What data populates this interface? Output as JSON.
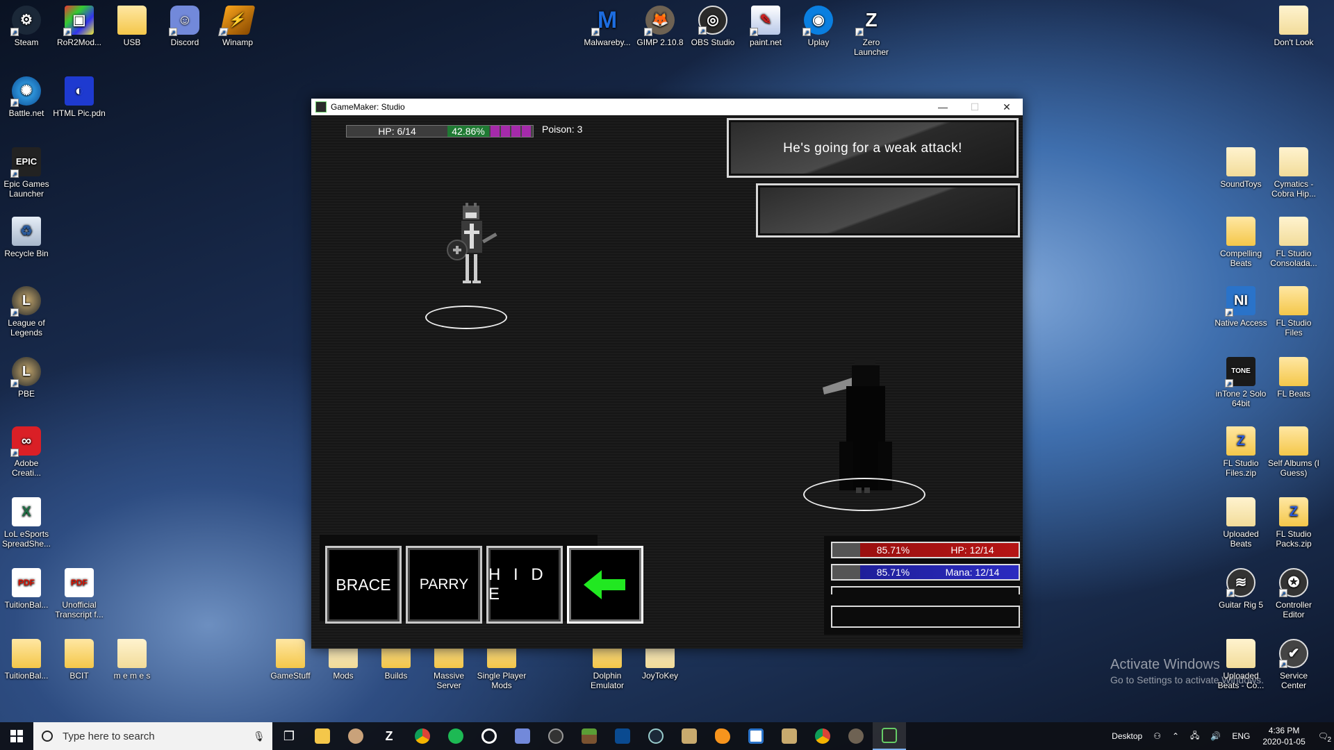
{
  "desktop": {
    "icons_left": [
      {
        "label": "Steam"
      },
      {
        "label": "RoR2Mod..."
      },
      {
        "label": "USB"
      },
      {
        "label": "Discord"
      },
      {
        "label": "Winamp"
      },
      {
        "label": "Battle.net"
      },
      {
        "label": "HTML Pic.pdn"
      },
      {
        "label": "Epic Games Launcher"
      },
      {
        "label": "Recycle Bin"
      },
      {
        "label": "League of Legends"
      },
      {
        "label": "PBE"
      },
      {
        "label": "Adobe Creati..."
      },
      {
        "label": "LoL eSports SpreadShe..."
      },
      {
        "label": "TuitionBal..."
      },
      {
        "label": "Unofficial Transcript f..."
      },
      {
        "label": "TuitionBal..."
      },
      {
        "label": "BCIT"
      },
      {
        "label": "m e m e s"
      }
    ],
    "icons_top": [
      {
        "label": "Malwareby..."
      },
      {
        "label": "GIMP 2.10.8"
      },
      {
        "label": "OBS Studio"
      },
      {
        "label": "paint.net"
      },
      {
        "label": "Uplay"
      },
      {
        "label": "Zero Launcher"
      }
    ],
    "icons_bottom": [
      {
        "label": "GameStuff"
      },
      {
        "label": "Mods"
      },
      {
        "label": "Builds"
      },
      {
        "label": "Massive Server"
      },
      {
        "label": "Single Player Mods"
      },
      {
        "label": "Dolphin Emulator"
      },
      {
        "label": "JoyToKey"
      }
    ],
    "icons_right": [
      {
        "label": "Don't Look"
      },
      {
        "label": "SoundToys"
      },
      {
        "label": "Cymatics - Cobra Hip..."
      },
      {
        "label": "Compelling Beats"
      },
      {
        "label": "FL Studio Consolada..."
      },
      {
        "label": "Native Access"
      },
      {
        "label": "FL Studio Files"
      },
      {
        "label": "inTone 2 Solo 64bit"
      },
      {
        "label": "FL Beats"
      },
      {
        "label": "FL Studio Files.zip"
      },
      {
        "label": "Self Albums (I Guess)"
      },
      {
        "label": "Uploaded Beats"
      },
      {
        "label": "FL Studio Packs.zip"
      },
      {
        "label": "Guitar Rig 5"
      },
      {
        "label": "Controller Editor"
      },
      {
        "label": "Uploaded Beats - Co..."
      },
      {
        "label": "Service Center"
      }
    ],
    "watermark": {
      "line1": "Activate Windows",
      "line2": "Go to Settings to activate Windows."
    }
  },
  "window": {
    "title": "GameMaker: Studio",
    "min": "—",
    "max": "☐",
    "close": "✕"
  },
  "game": {
    "player": {
      "hp_text": "HP: 6/14",
      "pct": "42.86%",
      "status": "Poison: 3"
    },
    "message": "He's going for a weak attack!",
    "actions": [
      {
        "label": "BRACE"
      },
      {
        "label": "PARRY"
      },
      {
        "label": "H I D E"
      },
      {
        "label": "back"
      }
    ],
    "enemy_status": {
      "hp_pct": "85.71%",
      "hp_text": "HP: 12/14",
      "mana_pct": "85.71%",
      "mana_text": "Mana: 12/14"
    }
  },
  "taskbar": {
    "search_placeholder": "Type here to search",
    "desktop_label": "Desktop",
    "lang": "ENG",
    "time": "4:36 PM",
    "date": "2020-01-05",
    "notif_count": "2"
  },
  "colors": {
    "accent_green": "#21e821",
    "hp_red": "#b51515",
    "mana_blue": "#2b2bc0",
    "poison_purple": "#a52aaa"
  }
}
